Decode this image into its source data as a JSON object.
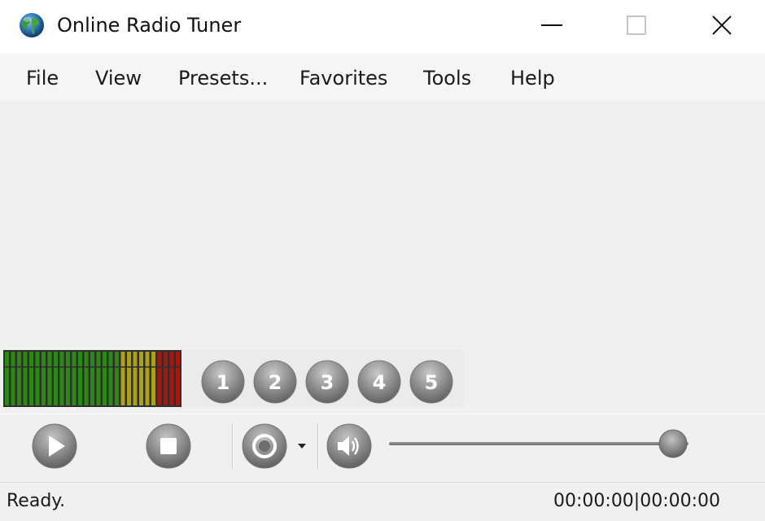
{
  "window": {
    "title": "Online Radio Tuner",
    "app_icon": "globe-icon",
    "controls": [
      "minimize-icon",
      "maximize-icon",
      "close-icon"
    ]
  },
  "menu": {
    "items": [
      {
        "label": "File"
      },
      {
        "label": "View"
      },
      {
        "label": "Presets..."
      },
      {
        "label": "Favorites"
      },
      {
        "label": "Tools"
      },
      {
        "label": "Help"
      }
    ]
  },
  "presets": {
    "buttons": [
      {
        "label": "1"
      },
      {
        "label": "2"
      },
      {
        "label": "3"
      },
      {
        "label": "4"
      },
      {
        "label": "5"
      }
    ]
  },
  "transport": {
    "play_icon": "play-icon",
    "stop_icon": "stop-icon",
    "record_icon": "record-icon",
    "record_menu_icon": "dropdown-arrow-icon",
    "volume_icon": "speaker-icon",
    "volume_level": 1.0
  },
  "status": {
    "text": "Ready.",
    "time": "00:00:00|00:00:00"
  },
  "colors": {
    "vu_green": "#2c8a14",
    "vu_yellow": "#a9a21a",
    "vu_red": "#a3180f",
    "button_grey": "#8a8a8a"
  }
}
